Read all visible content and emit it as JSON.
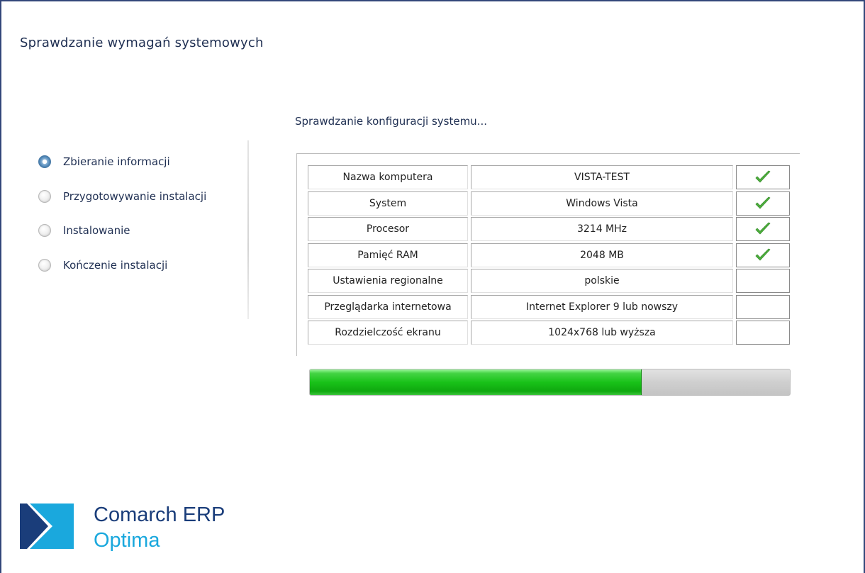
{
  "title": "Sprawdzanie wymagań systemowych",
  "steps": [
    {
      "label": "Zbieranie informacji",
      "state": "active"
    },
    {
      "label": "Przygotowywanie instalacji",
      "state": "inactive"
    },
    {
      "label": "Instalowanie",
      "state": "inactive"
    },
    {
      "label": "Kończenie instalacji",
      "state": "inactive"
    }
  ],
  "status_text": "Sprawdzanie konfiguracji systemu...",
  "requirements": [
    {
      "name": "Nazwa komputera",
      "value": "VISTA-TEST",
      "checked": true
    },
    {
      "name": "System",
      "value": "Windows Vista",
      "checked": true
    },
    {
      "name": "Procesor",
      "value": "3214 MHz",
      "checked": true
    },
    {
      "name": "Pamięć RAM",
      "value": "2048 MB",
      "checked": true
    },
    {
      "name": "Ustawienia regionalne",
      "value": "polskie",
      "checked": false
    },
    {
      "name": "Przeglądarka internetowa",
      "value": "Internet Explorer 9 lub nowszy",
      "checked": false
    },
    {
      "name": "Rozdzielczość ekranu",
      "value": "1024x768 lub wyższa",
      "checked": false
    }
  ],
  "progress": {
    "percent": 69
  },
  "logo": {
    "line1": "Comarch ERP",
    "line2": "Optima",
    "icon": "comarch-logo-icon"
  },
  "colors": {
    "text": "#1f2f52",
    "check_green": "#4caf3c",
    "progress_green": "#19c219",
    "brand_dark": "#1a3d7a",
    "brand_light": "#1aa8dd"
  }
}
